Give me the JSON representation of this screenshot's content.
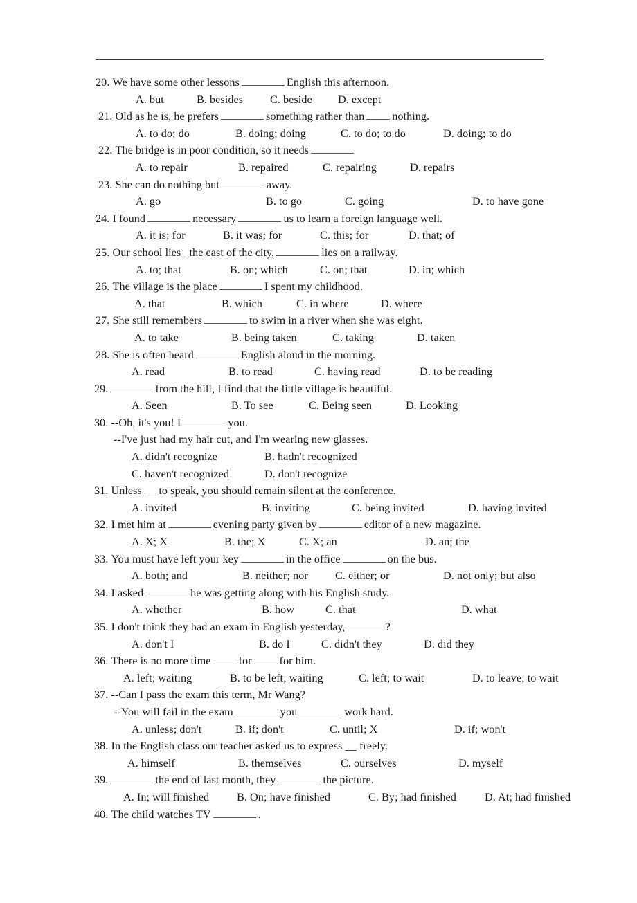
{
  "document": {
    "type": "english-grammar-worksheet",
    "has_header_rule": true,
    "text_color": "#1a1a1a",
    "rule_color": "#3a3a3a"
  },
  "questions": [
    {
      "number": "20.",
      "stem_before": "We have some other lessons",
      "blank1": "",
      "stem_after": "English this afternoon.",
      "options": [
        {
          "label": "A. but"
        },
        {
          "label": "B. besides"
        },
        {
          "label": "C. beside"
        },
        {
          "label": "D. except"
        }
      ]
    },
    {
      "number": "21.",
      "stem_before": "Old as he is, he prefers",
      "stem_mid": "something rather than",
      "stem_after": "nothing.",
      "options": [
        {
          "label": "A. to do; do"
        },
        {
          "label": "B. doing; doing"
        },
        {
          "label": "C. to do; to do"
        },
        {
          "label": "D. doing; to do"
        }
      ]
    },
    {
      "number": "22.",
      "stem_before": "The bridge is in poor condition, so it needs",
      "stem_after": "",
      "options": [
        {
          "label": "A. to repair"
        },
        {
          "label": "B. repaired"
        },
        {
          "label": "C. repairing"
        },
        {
          "label": "D. repairs"
        }
      ]
    },
    {
      "number": "23.",
      "stem_before": "She can do nothing but",
      "stem_after": "away.",
      "options": [
        {
          "label": "A. go"
        },
        {
          "label": "B. to go"
        },
        {
          "label": "C. going"
        },
        {
          "label": "D. to have gone"
        }
      ]
    },
    {
      "number": "24.",
      "stem_before": "I found",
      "stem_mid": "necessary",
      "stem_after": "us to learn a foreign language well.",
      "options": [
        {
          "label": "A. it is; for"
        },
        {
          "label": "B. it was; for"
        },
        {
          "label": "C. this; for"
        },
        {
          "label": "D. that; of"
        }
      ]
    },
    {
      "number": "25.",
      "stem_before": "Our school lies _the east of the city,",
      "stem_after": "lies on a railway.",
      "options": [
        {
          "label": "A. to; that"
        },
        {
          "label": "B. on; which"
        },
        {
          "label": "C. on; that"
        },
        {
          "label": "D. in; which"
        }
      ]
    },
    {
      "number": "26.",
      "stem_before": "The village is the place",
      "stem_after": "I spent my childhood.",
      "options": [
        {
          "label": "A. that"
        },
        {
          "label": "B. which"
        },
        {
          "label": "C. in where"
        },
        {
          "label": "D. where"
        }
      ]
    },
    {
      "number": "27.",
      "stem_before": "She still remembers",
      "stem_after": "to swim in a river when she was eight.",
      "options": [
        {
          "label": "A. to take"
        },
        {
          "label": "B. being taken"
        },
        {
          "label": "C. taking"
        },
        {
          "label": "D. taken"
        }
      ]
    },
    {
      "number": "28.",
      "stem_before": "She is often heard",
      "stem_after": "English aloud in the morning.",
      "options": [
        {
          "label": "A. read"
        },
        {
          "label": "B. to read"
        },
        {
          "label": "C. having read"
        },
        {
          "label": "D. to be reading"
        }
      ]
    },
    {
      "number": "29.",
      "stem_before": "",
      "stem_after": "from the hill, I find that the little village is beautiful.",
      "options": [
        {
          "label": "A. Seen"
        },
        {
          "label": "B. To see"
        },
        {
          "label": "C. Being seen"
        },
        {
          "label": "D. Looking"
        }
      ]
    },
    {
      "number": "30.",
      "stem_before": "--Oh, it's you!   I",
      "stem_after": "you.",
      "second_line": "--I've just had my hair cut, and I'm wearing new glasses.",
      "options": [
        {
          "label": "A. didn't recognize"
        },
        {
          "label": "B. hadn't recognized"
        },
        {
          "label": "C. haven't recognized"
        },
        {
          "label": "D. don't recognize"
        }
      ]
    },
    {
      "number": "31.",
      "stem_before": "Unless __ to speak, you should remain silent at the conference.",
      "options": [
        {
          "label": "A. invited"
        },
        {
          "label": "B. inviting"
        },
        {
          "label": "C. being invited"
        },
        {
          "label": "D. having invited"
        }
      ]
    },
    {
      "number": "32.",
      "stem_before": "I met him at",
      "stem_mid": "evening party given by",
      "stem_after": "editor of a new magazine.",
      "options": [
        {
          "label": "A. X; X"
        },
        {
          "label": "B. the; X"
        },
        {
          "label": "C. X; an"
        },
        {
          "label": "D. an; the"
        }
      ]
    },
    {
      "number": "33.",
      "stem_before": "You must have left your key",
      "stem_mid": "in the office",
      "stem_after": "on the bus.",
      "options": [
        {
          "label": "A. both; and"
        },
        {
          "label": "B. neither; nor"
        },
        {
          "label": "C. either; or"
        },
        {
          "label": "D. not only; but also"
        }
      ]
    },
    {
      "number": "34.",
      "stem_before": "I asked",
      "stem_after": "he was getting along with his English study.",
      "options": [
        {
          "label": "A. whether"
        },
        {
          "label": "B. how"
        },
        {
          "label": "C. that"
        },
        {
          "label": "D. what"
        }
      ]
    },
    {
      "number": "35.",
      "stem_before": "I don't think they had an exam in English yesterday,",
      "stem_after": "?",
      "options": [
        {
          "label": "A. don't I"
        },
        {
          "label": "B. do I"
        },
        {
          "label": "C. didn't they"
        },
        {
          "label": "D. did they"
        }
      ]
    },
    {
      "number": "36.",
      "stem_before": "There is no more time",
      "stem_mid": "for",
      "stem_after": "for him.",
      "options": [
        {
          "label": "A. left; waiting"
        },
        {
          "label": "B. to be left; waiting"
        },
        {
          "label": "C. left; to wait"
        },
        {
          "label": "D. to leave; to wait"
        }
      ]
    },
    {
      "number": "37.",
      "stem_before": "--Can I pass the exam this term, Mr Wang?",
      "second_line_before": "--You will fail in the exam",
      "second_line_mid": "you",
      "second_line_after": "work hard.",
      "options": [
        {
          "label": "A. unless; don't"
        },
        {
          "label": "B. if; don't"
        },
        {
          "label": "C. until; X"
        },
        {
          "label": "D. if; won't"
        }
      ]
    },
    {
      "number": "38.",
      "stem_before": "In the English class our teacher asked us to express __ freely.",
      "options": [
        {
          "label": "A. himself"
        },
        {
          "label": "B. themselves"
        },
        {
          "label": "C. ourselves"
        },
        {
          "label": "D. myself"
        }
      ]
    },
    {
      "number": "39.",
      "stem_before": "",
      "stem_mid": "the end of last month, they",
      "stem_after": "the picture.",
      "options": [
        {
          "label": "A. In; will finished"
        },
        {
          "label": "B. On; have finished"
        },
        {
          "label": "C. By; had finished"
        },
        {
          "label": "D. At; had finished"
        }
      ]
    },
    {
      "number": "40.",
      "stem_before": "The child watches TV",
      "stem_after": ".",
      "options": []
    }
  ]
}
